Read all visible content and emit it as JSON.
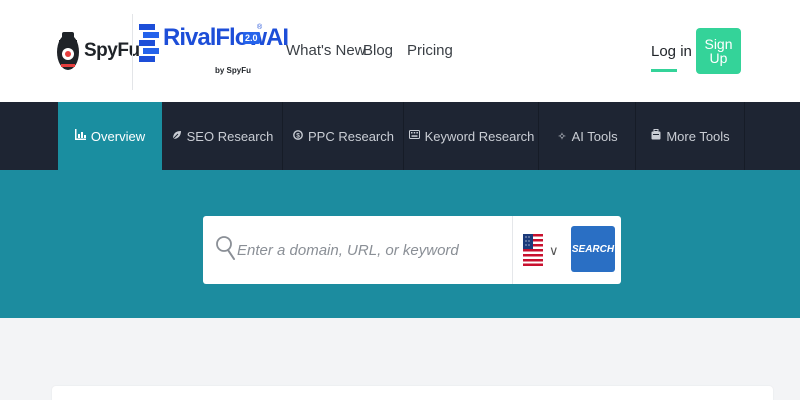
{
  "header": {
    "spyfu_logo_text": "SpyFu",
    "rivalflow_logo_text": "RivalFlow",
    "rivalflow_logo_ai": "AI",
    "rivalflow_version": "2.0",
    "rivalflow_by": "by SpyFu",
    "nav": [
      {
        "label": "What's New"
      },
      {
        "label": "Blog"
      },
      {
        "label": "Pricing"
      }
    ],
    "login_label": "Log in",
    "signup_label": "Sign Up"
  },
  "toolnav": {
    "tabs": [
      {
        "label": "Overview",
        "icon": "bar-chart-icon",
        "active": true
      },
      {
        "label": "SEO Research",
        "icon": "leaf-icon",
        "active": false
      },
      {
        "label": "PPC Research",
        "icon": "ppc-icon",
        "active": false
      },
      {
        "label": "Keyword Research",
        "icon": "keyboard-icon",
        "active": false
      },
      {
        "label": "AI Tools",
        "icon": "sparkle-icon",
        "active": false
      },
      {
        "label": "More Tools",
        "icon": "toolbox-icon",
        "active": false
      }
    ]
  },
  "search": {
    "placeholder": "Enter a domain, URL, or keyword",
    "value": "",
    "country_icon": "us-flag-icon",
    "button_label": "SEARCH"
  },
  "colors": {
    "accent_green": "#34d399",
    "hero_teal": "#1c8c9f",
    "nav_dark": "#1e2533",
    "search_blue": "#2a6fc4",
    "brand_blue": "#1d4ed8"
  }
}
